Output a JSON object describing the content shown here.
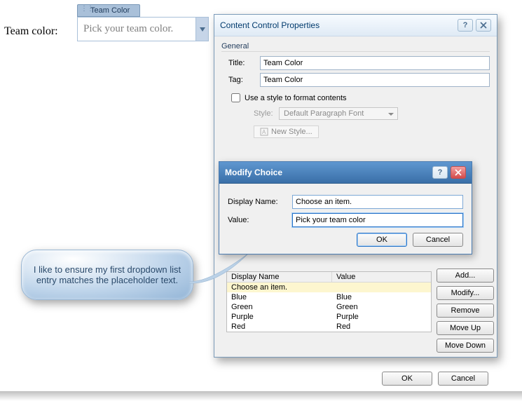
{
  "doc": {
    "label": "Team color:",
    "cc_tab": "Team Color",
    "cc_placeholder": "Pick your team color."
  },
  "dlg": {
    "title": "Content Control Properties",
    "general": "General",
    "title_label": "Title:",
    "title_value": "Team Color",
    "tag_label": "Tag:",
    "tag_value": "Team Color",
    "use_style": "Use a style to format contents",
    "style_label": "Style:",
    "style_value": "Default Paragraph Font",
    "new_style": "New Style..."
  },
  "sub": {
    "title": "Modify Choice",
    "display_label": "Display Name:",
    "display_value": "Choose an item.",
    "value_label": "Value:",
    "value_value": "Pick your team color",
    "ok": "OK",
    "cancel": "Cancel"
  },
  "list": {
    "hdr_display": "Display Name",
    "hdr_value": "Value",
    "rows": [
      {
        "d": "Choose an item.",
        "v": ""
      },
      {
        "d": "Blue",
        "v": "Blue"
      },
      {
        "d": "Green",
        "v": "Green"
      },
      {
        "d": "Purple",
        "v": "Purple"
      },
      {
        "d": "Red",
        "v": "Red"
      }
    ]
  },
  "side": {
    "add": "Add...",
    "modify": "Modify...",
    "remove": "Remove",
    "up": "Move Up",
    "down": "Move Down"
  },
  "bottom": {
    "ok": "OK",
    "cancel": "Cancel"
  },
  "callout": "I like to ensure my first dropdown list entry matches the placeholder text."
}
